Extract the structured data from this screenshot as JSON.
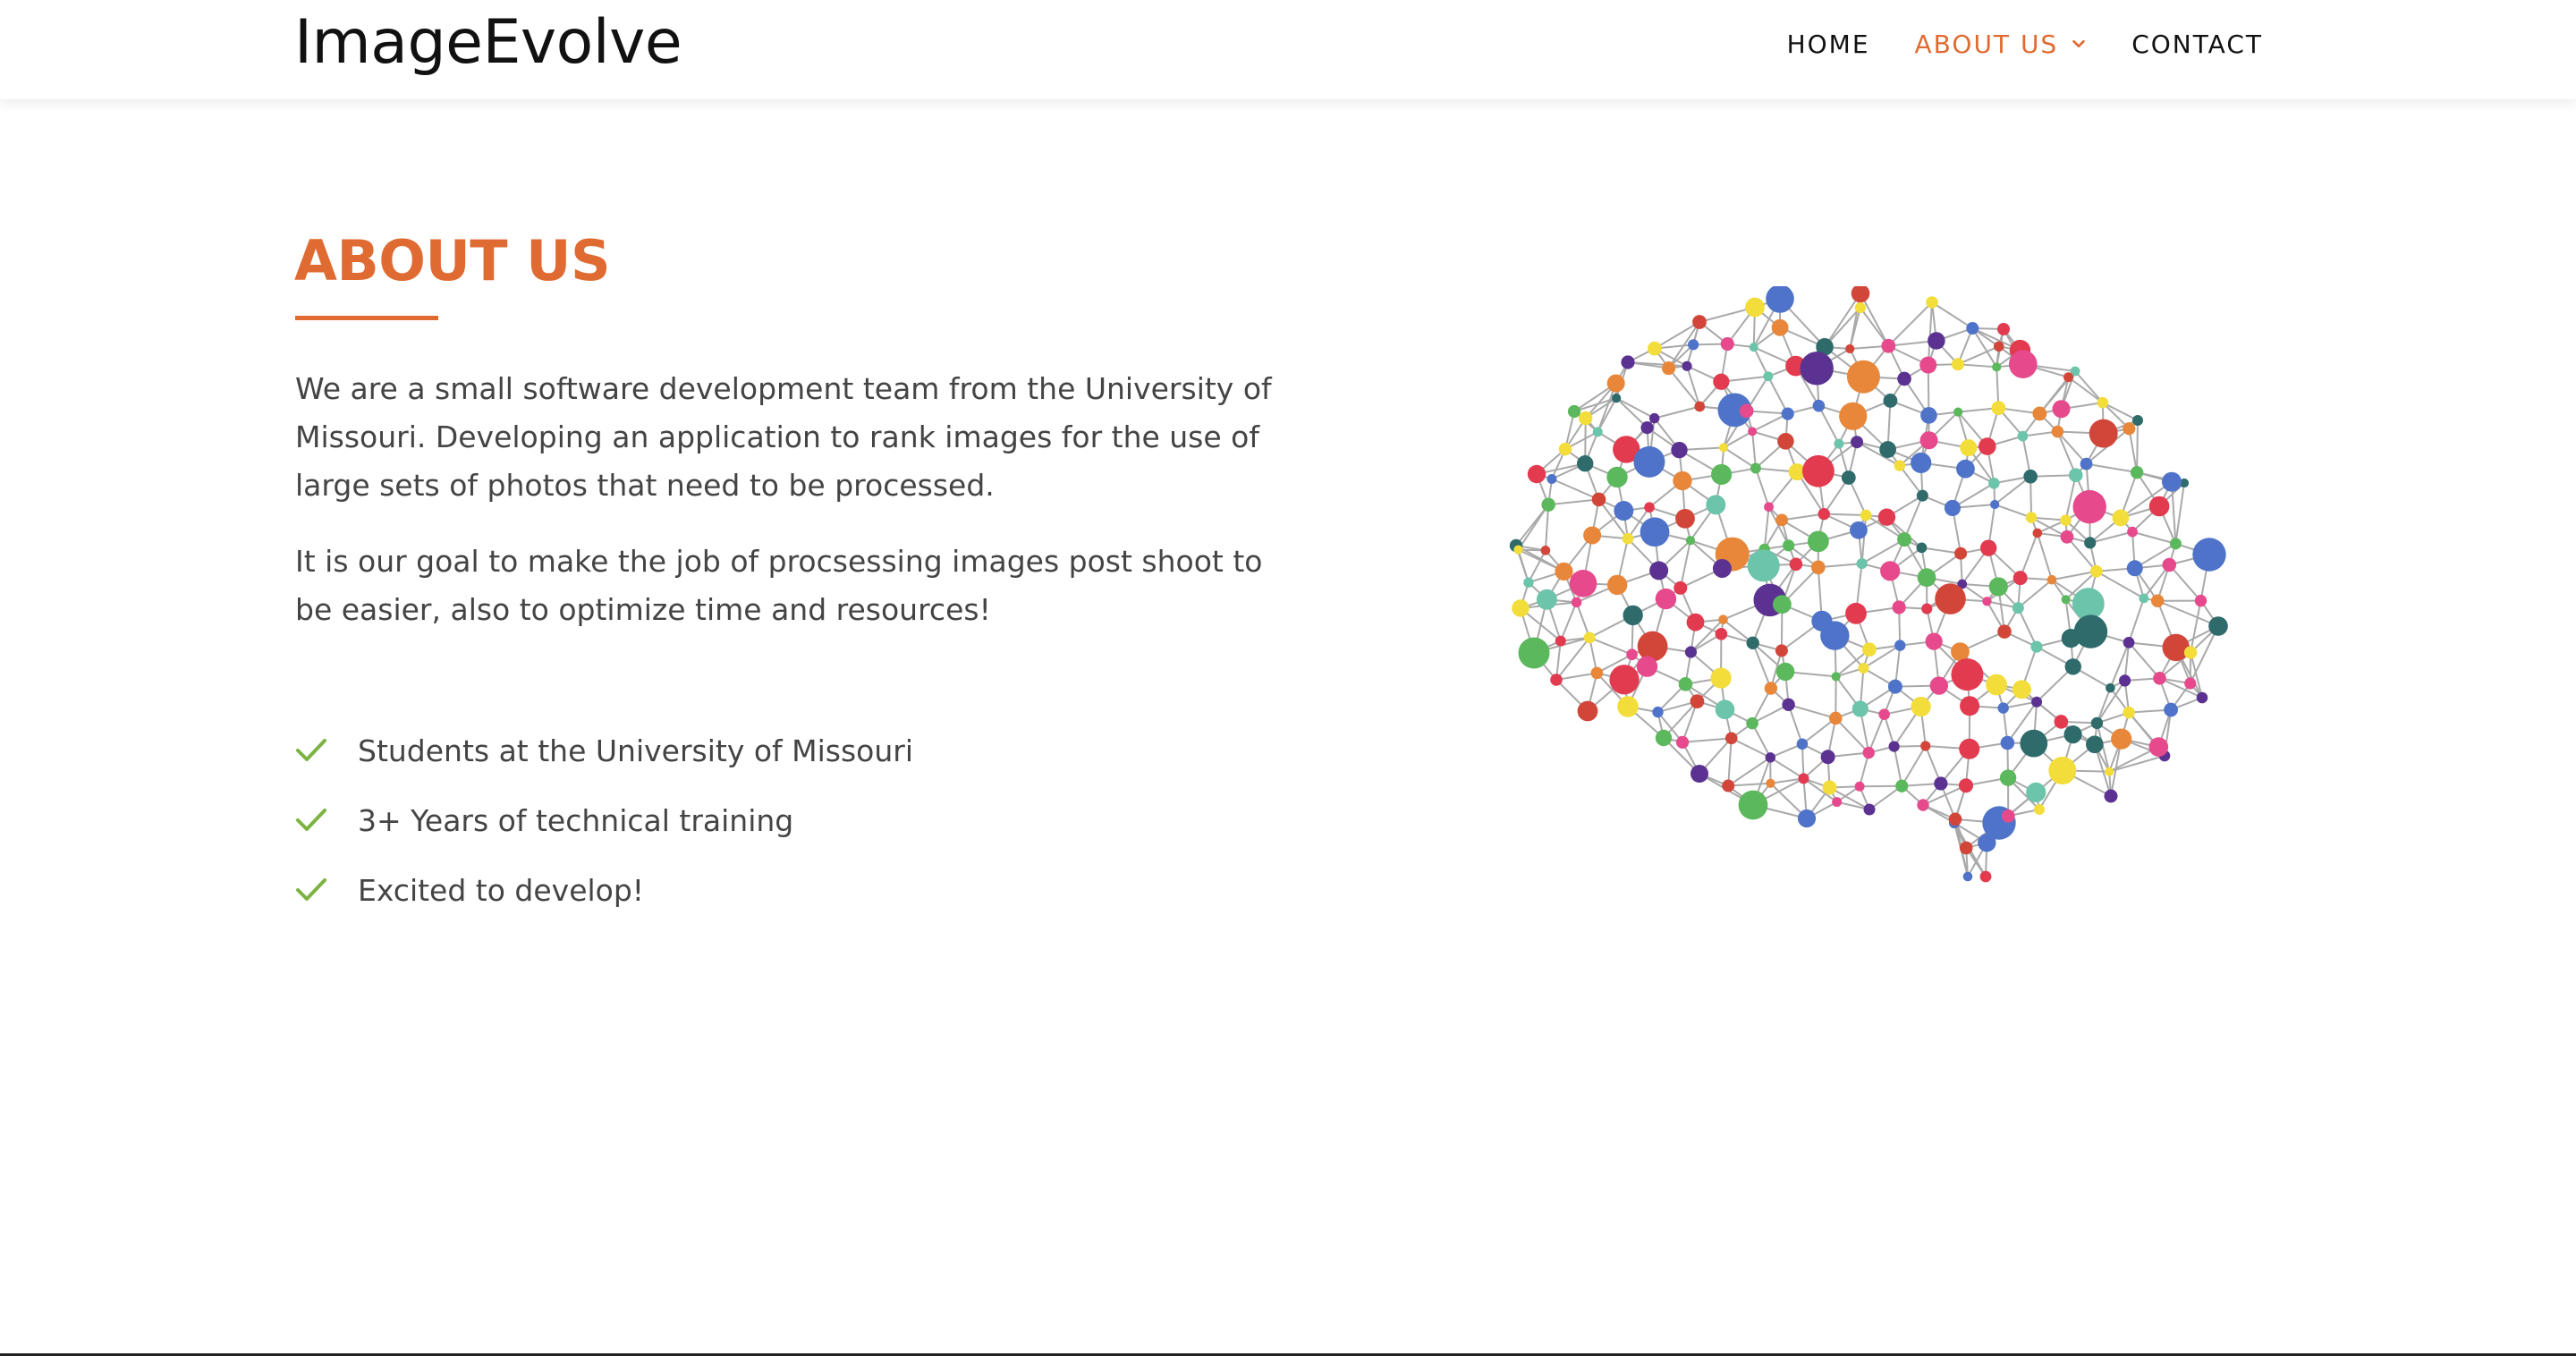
{
  "header": {
    "logo": "ImageEvolve",
    "nav": [
      {
        "label": "HOME"
      },
      {
        "label": "ABOUT US",
        "icon": "chevron-down-icon"
      },
      {
        "label": "CONTACT"
      }
    ]
  },
  "main": {
    "title": "ABOUT US",
    "paragraphs": [
      "We are a small software development team from the University of Missouri. Developing an application to rank images for the use of large sets of photos that need to be processed.",
      "It is our goal to make the job of procsessing images post shoot to be easier, also to optimize time and resources!"
    ],
    "features": [
      {
        "text": "Students at the University of Missouri",
        "icon": "checkmark-icon"
      },
      {
        "text": "3+ Years of technical training",
        "icon": "checkmark-icon"
      },
      {
        "text": "Excited to develop!",
        "icon": "checkmark-icon"
      }
    ],
    "illustration": "brain-network-illustration"
  },
  "colors": {
    "accent": "#e06b32",
    "check": "#7cb342",
    "text": "#444444",
    "heading_dark": "#111111",
    "brain_palette": [
      "#e23a4f",
      "#e64a8c",
      "#4f73c9",
      "#6cc4aa",
      "#e8873a",
      "#2f6b6b",
      "#5b3291",
      "#d2463a",
      "#f2dd3a",
      "#5cb85c"
    ]
  }
}
